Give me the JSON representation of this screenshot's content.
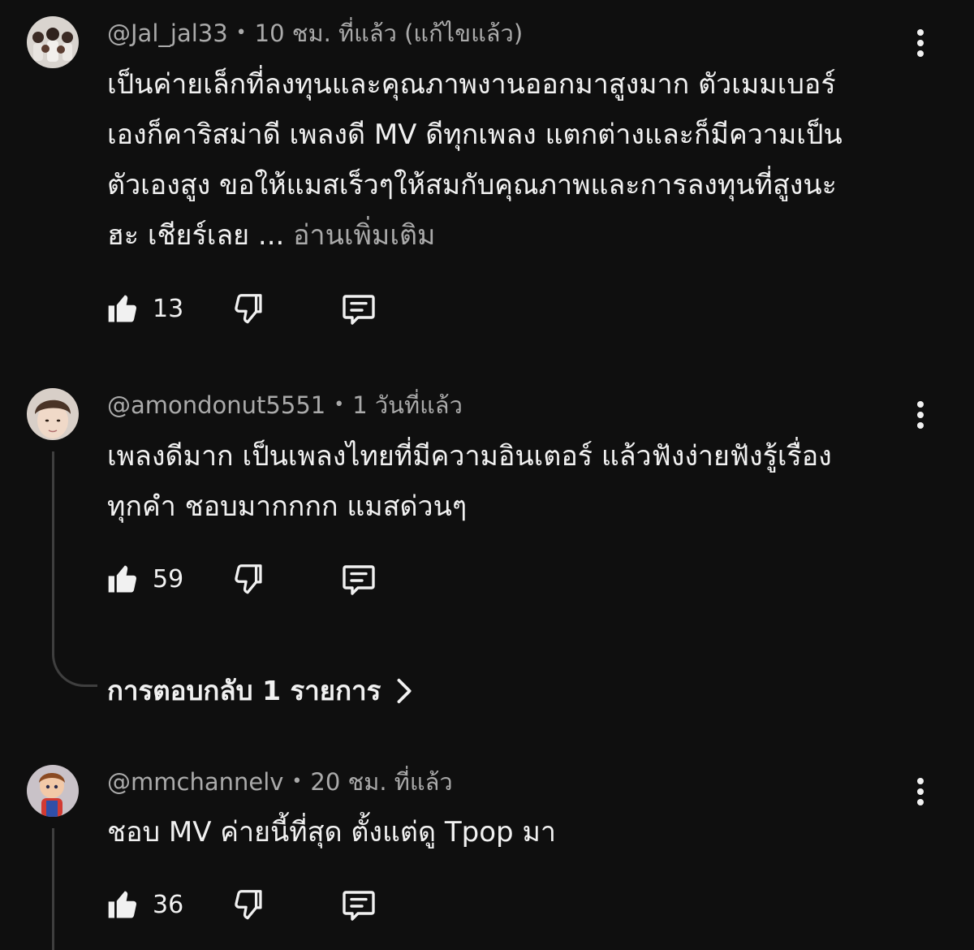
{
  "comments": [
    {
      "author": "@Jal_jal33",
      "time": "10 ชม. ที่แล้ว",
      "edited": "(แก้ไขแล้ว)",
      "lines": [
        "เป็นค่ายเล็กที่ลงทุนและคุณภาพงานออกมาสูงมาก ตัวเมมเบอร์",
        "เองก็คาริสม่าดี เพลงดี MV ดีทุกเพลง แตกต่างและก็มีความเป็น",
        "ตัวเองสูง ขอให้แมสเร็วๆให้สมกับคุณภาพและการลงทุนที่สูงนะ",
        "ฮะ เชียร์เลย ..."
      ],
      "read_more": "อ่านเพิ่มเติม",
      "likes": "13"
    },
    {
      "author": "@amondonut5551",
      "time": "1 วันที่แล้ว",
      "lines": [
        "เพลงดีมาก เป็นเพลงไทยที่มีความอินเตอร์ แล้วฟังง่ายฟังรู้เรื่อง",
        "ทุกคำ ชอบมากกกก แมสด่วนๆ"
      ],
      "likes": "59",
      "replies_label": "การตอบกลับ 1 รายการ"
    },
    {
      "author": "@mmchannelv",
      "time": "20 ชม. ที่แล้ว",
      "lines": [
        "ชอบ MV ค่ายนี้ที่สุด ตั้งแต่ดู Tpop มา"
      ],
      "likes": "36"
    }
  ],
  "colors": {
    "background": "#0f0f0f",
    "text": "#f1f1f1",
    "secondary": "#aaaaaa",
    "thread": "#3f3f3f"
  },
  "icons": [
    "thumbs-up-icon",
    "thumbs-down-icon",
    "reply-icon",
    "more-vert-icon",
    "chevron-right-icon"
  ]
}
